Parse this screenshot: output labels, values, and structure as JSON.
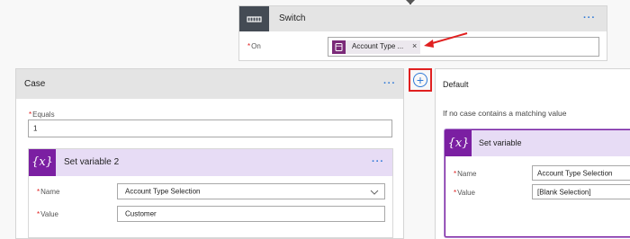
{
  "switch": {
    "title": "Switch",
    "on_label": "On",
    "required_mark": "*",
    "token_label": "Account Type ...",
    "token_close": "×",
    "more": "···"
  },
  "case": {
    "title": "Case",
    "more": "···",
    "equals_label": "Equals",
    "required_mark": "*",
    "equals_value": "1",
    "action": {
      "icon_text": "{x}",
      "title": "Set variable 2",
      "more": "···",
      "name_label": "Name",
      "name_value": "Account Type Selection",
      "value_label": "Value",
      "value_value": "Customer"
    }
  },
  "add_button": {
    "symbol": "+"
  },
  "default": {
    "title": "Default",
    "description": "If no case contains a matching value",
    "action": {
      "icon_text": "{x}",
      "title": "Set variable",
      "name_label": "Name",
      "name_value": "Account Type Selection",
      "value_label": "Value",
      "value_value": "[Blank Selection]"
    }
  },
  "colors": {
    "accent_blue": "#2f79d6",
    "variable_purple": "#7b1fa2",
    "annotation_red": "#e02020"
  }
}
